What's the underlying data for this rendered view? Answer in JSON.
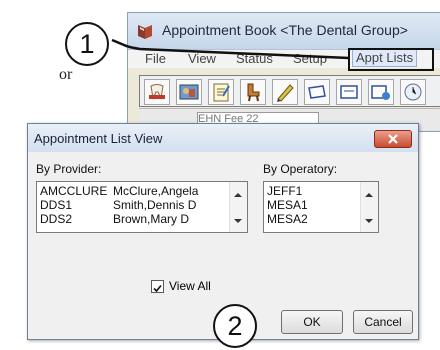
{
  "page_fragment": {
    "text": "or"
  },
  "app_window": {
    "title": "Appointment Book <The Dental Group>",
    "menu": [
      "File",
      "View",
      "Status",
      "Setup",
      "Appt Lists"
    ],
    "highlighted_menu": "Appt Lists",
    "toolbar_field_text": "EHN Fee 22",
    "toolbar_icons": [
      "tooth-icon",
      "photo-icon",
      "notes-icon",
      "chair-icon",
      "pen-icon",
      "box-icon",
      "card-icon",
      "recall-icon",
      "clock-icon"
    ]
  },
  "callouts": {
    "first": "1",
    "second": "2"
  },
  "dialog": {
    "title": "Appointment List View",
    "by_provider_label": "By Provider:",
    "by_operatory_label": "By Operatory:",
    "providers": [
      {
        "code": "AMCCLURE",
        "name": "McClure,Angela"
      },
      {
        "code": "DDS1",
        "name": "Smith,Dennis  D"
      },
      {
        "code": "DDS2",
        "name": "Brown,Mary  D"
      }
    ],
    "operatories": [
      "JEFF1",
      "MESA1",
      "MESA2"
    ],
    "view_all_label": "View All",
    "view_all_checked": true,
    "ok_label": "OK",
    "cancel_label": "Cancel"
  }
}
